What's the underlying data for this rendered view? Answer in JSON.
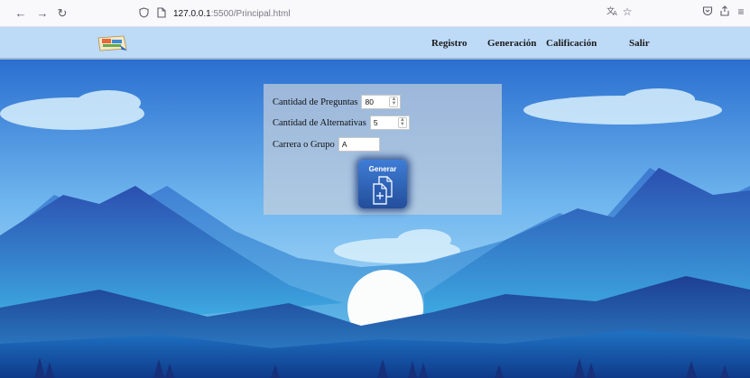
{
  "browser": {
    "url_host": "127.0.0.1",
    "url_path": ":5500/Principal.html"
  },
  "nav": {
    "links": [
      "Registro",
      "Generación",
      "Calificación",
      "Salir"
    ]
  },
  "form": {
    "questions_label": "Cantidad de Preguntas",
    "questions_value": "80",
    "alternatives_label": "Cantidad de Alternativas",
    "alternatives_value": "5",
    "group_label": "Carrera o Grupo",
    "group_value": "A",
    "generate_label": "Generar"
  },
  "icons": {
    "back": "arrow-left-icon",
    "forward": "arrow-right-icon",
    "reload": "reload-icon",
    "shield": "shield-icon",
    "page": "page-icon",
    "translate": "translate-icon",
    "bookmark": "star-icon",
    "pocket": "pocket-icon",
    "share": "share-icon",
    "menu": "menu-icon",
    "generate": "copy-add-icon"
  },
  "colors": {
    "nav_bg": "#bddaf7",
    "sky_top": "#2a6fd0",
    "sky_bottom": "#bfe3f8",
    "button_bg": "#2f63b8"
  }
}
